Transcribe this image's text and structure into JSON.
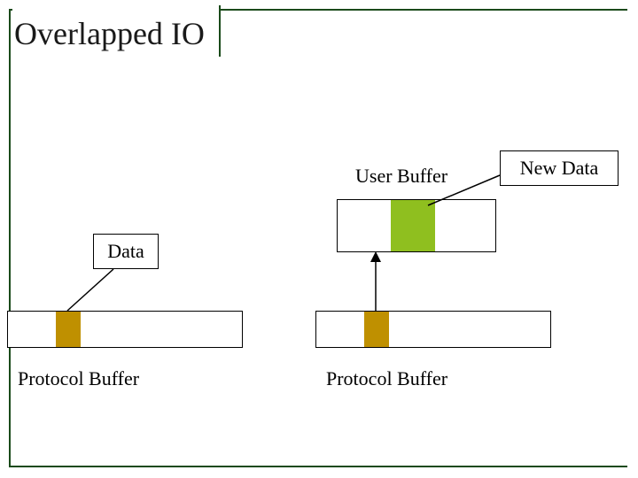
{
  "title": "Overlapped IO",
  "labels": {
    "user_buffer": "User Buffer",
    "new_data": "New Data",
    "data": "Data",
    "protocol_buffer_left": "Protocol Buffer",
    "protocol_buffer_right": "Protocol Buffer"
  },
  "colors": {
    "frame": "#1a4a1a",
    "data_fill": "#bf9000",
    "new_data_fill": "#8fbf1f"
  },
  "chart_data": {
    "type": "diagram",
    "title": "Overlapped IO",
    "elements": [
      {
        "id": "data-label",
        "type": "label-box",
        "text": "Data"
      },
      {
        "id": "user-buffer-label",
        "type": "text",
        "text": "User Buffer"
      },
      {
        "id": "new-data-label",
        "type": "label-box",
        "text": "New Data"
      },
      {
        "id": "left-protocol-buffer",
        "type": "buffer",
        "fills": [
          {
            "color": "#bf9000",
            "position": "left-segment"
          }
        ]
      },
      {
        "id": "user-buffer",
        "type": "buffer",
        "fills": [
          {
            "color": "#8fbf1f",
            "position": "center-segment"
          }
        ]
      },
      {
        "id": "right-protocol-buffer",
        "type": "buffer",
        "fills": [
          {
            "color": "#bf9000",
            "position": "left-segment"
          }
        ]
      },
      {
        "id": "left-protocol-buffer-label",
        "type": "text",
        "text": "Protocol Buffer"
      },
      {
        "id": "right-protocol-buffer-label",
        "type": "text",
        "text": "Protocol Buffer"
      }
    ],
    "connections": [
      {
        "from": "data-label",
        "to": "left-protocol-buffer.fill",
        "style": "line"
      },
      {
        "from": "new-data-label",
        "to": "user-buffer.fill",
        "style": "line-via-user-buffer-label"
      },
      {
        "from": "right-protocol-buffer.fill",
        "to": "user-buffer",
        "style": "arrow-up"
      }
    ]
  }
}
